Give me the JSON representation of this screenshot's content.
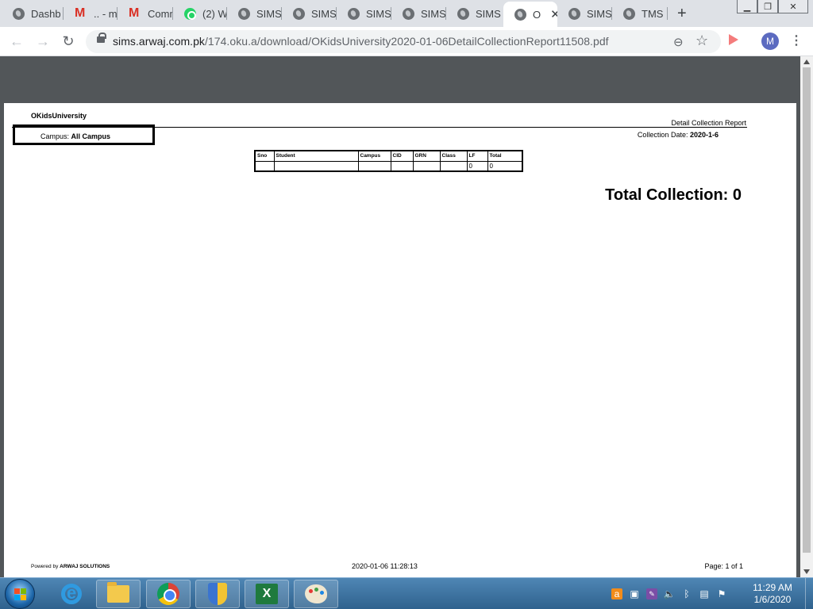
{
  "browser": {
    "tabs": [
      {
        "label": "Dashb",
        "icon": "globe-icon"
      },
      {
        "label": ".. - ma",
        "icon": "gmail-icon"
      },
      {
        "label": "Comm",
        "icon": "gmail-icon"
      },
      {
        "label": "(2) W",
        "icon": "whatsapp-icon"
      },
      {
        "label": "SIMS",
        "icon": "globe-icon"
      },
      {
        "label": "SIMS",
        "icon": "globe-icon"
      },
      {
        "label": "SIMS",
        "icon": "globe-icon"
      },
      {
        "label": "SIMS",
        "icon": "globe-icon"
      },
      {
        "label": "SIMS",
        "icon": "globe-icon"
      },
      {
        "label": "O",
        "icon": "globe-icon",
        "active": true
      },
      {
        "label": "SIMS",
        "icon": "globe-icon"
      },
      {
        "label": "TMS",
        "icon": "globe-icon"
      }
    ],
    "active_tab_close": "✕",
    "new_tab": "+",
    "window_buttons": {
      "minimize": "▁",
      "restore": "❐",
      "close": "✕"
    },
    "url_host": "sims.arwaj.com.pk",
    "url_path": "/174.oku.a/download/OKidsUniversity2020-01-06DetailCollectionReport11508.pdf",
    "profile_initial": "M"
  },
  "report": {
    "org_name": "OKidsUniversity",
    "title": "Detail Collection Report",
    "campus_label": "Campus: ",
    "campus_value": "All Campus",
    "collection_date_label": "Collection Date: ",
    "collection_date_value": "2020-1-6",
    "table": {
      "headers": [
        "Sno",
        "Student",
        "Campus",
        "CID",
        "GRN",
        "Class",
        "LF",
        "Total"
      ],
      "rows": [
        [
          "",
          "",
          "",
          "",
          "",
          "",
          "0",
          "0"
        ]
      ]
    },
    "total_collection": "Total Collection: 0",
    "footer_powered_by": "Powered by ",
    "footer_company": "ARWAJ SOLUTIONS",
    "footer_timestamp": "2020-01-06 11:28:13",
    "footer_page": "Page: 1 of 1"
  },
  "taskbar": {
    "time": "11:29 AM",
    "date": "1/6/2020"
  },
  "colors": {
    "accent": "#5c6bc0",
    "viewer_bg": "#525659",
    "taskbar": "#3a6f9c"
  }
}
